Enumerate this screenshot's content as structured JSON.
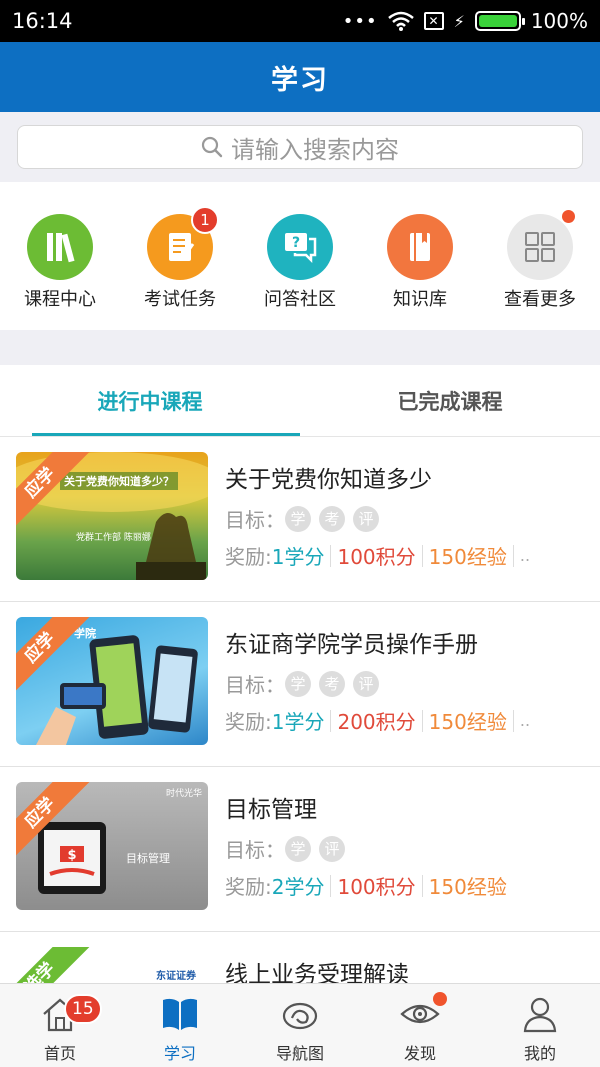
{
  "status_bar": {
    "time": "16:14",
    "signal_dots": "•••",
    "battery": "100%"
  },
  "header": {
    "title": "学习"
  },
  "search": {
    "placeholder": "请输入搜索内容"
  },
  "quick_entries": [
    {
      "label": "课程中心",
      "icon": "books-icon",
      "color": "#6cbc34"
    },
    {
      "label": "考试任务",
      "icon": "exam-clipboard-icon",
      "color": "#f59a1e",
      "badge": "1"
    },
    {
      "label": "问答社区",
      "icon": "qa-chat-icon",
      "color": "#1fb3bf"
    },
    {
      "label": "知识库",
      "icon": "book-icon",
      "color": "#f2763e"
    },
    {
      "label": "查看更多",
      "icon": "grid-icon",
      "color": "#e8e8e8",
      "dot": true
    }
  ],
  "tabs": [
    {
      "label": "进行中课程",
      "active": true
    },
    {
      "label": "已完成课程",
      "active": false
    }
  ],
  "courses": [
    {
      "ribbon": "应学",
      "ribbon_color": "#f07a3a",
      "thumb_caption": "关于党费你知道多少？",
      "thumb_sub": "党群工作部  陈丽娜",
      "title": "关于党费你知道多少",
      "goal_label": "目标：",
      "goals": [
        "学",
        "考",
        "评"
      ],
      "reward_label": "奖励:",
      "credit": "1学分",
      "points": "100积分",
      "exp": "150经验",
      "more": ".."
    },
    {
      "ribbon": "应学",
      "ribbon_color": "#f07a3a",
      "thumb_caption": "学院",
      "thumb_sub": "",
      "title": "东证商学院学员操作手册",
      "goal_label": "目标：",
      "goals": [
        "学",
        "考",
        "评"
      ],
      "reward_label": "奖励:",
      "credit": "1学分",
      "points": "200积分",
      "exp": "150经验",
      "more": ".."
    },
    {
      "ribbon": "应学",
      "ribbon_color": "#f07a3a",
      "thumb_caption": "目标管理",
      "thumb_sub": "时代光华",
      "title": "目标管理",
      "goal_label": "目标：",
      "goals": [
        "学",
        "评"
      ],
      "reward_label": "奖励:",
      "credit": "2学分",
      "points": "100积分",
      "exp": "150经验",
      "more": ""
    },
    {
      "ribbon": "选学",
      "ribbon_color": "#6cbc34",
      "thumb_caption": "东证证券",
      "thumb_sub": "",
      "title": "线上业务受理解读",
      "goal_label": "",
      "goals": [],
      "reward_label": "",
      "credit": "",
      "points": "",
      "exp": "",
      "more": ""
    }
  ],
  "bottom_nav": [
    {
      "label": "首页",
      "icon": "home-icon",
      "badge": "15",
      "active": false
    },
    {
      "label": "学习",
      "icon": "open-book-icon",
      "active": true
    },
    {
      "label": "导航图",
      "icon": "navigation-map-icon",
      "active": false
    },
    {
      "label": "发现",
      "icon": "eye-icon",
      "dot": true,
      "active": false
    },
    {
      "label": "我的",
      "icon": "person-icon",
      "active": false
    }
  ]
}
